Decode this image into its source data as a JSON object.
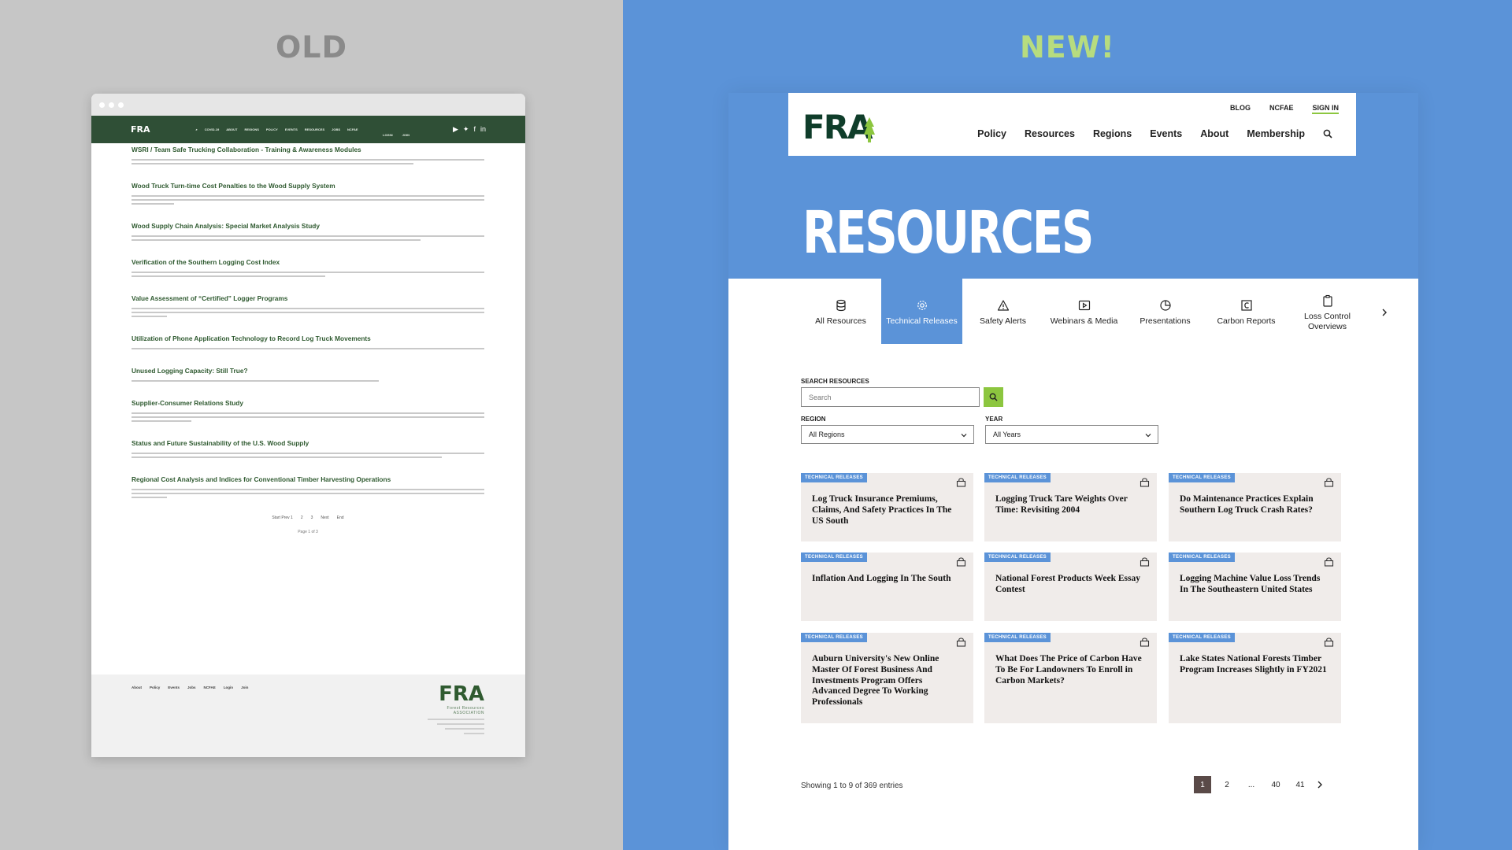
{
  "labels": {
    "old": "OLD",
    "new": "NEW!"
  },
  "old_site": {
    "logo": "FRA",
    "nav": [
      "COVID-19",
      "ABOUT",
      "REGIONS",
      "POLICY",
      "EVENTS",
      "RESOURCES",
      "JOBS",
      "NCFAE"
    ],
    "nav_secondary": [
      "LOGIN",
      "JOIN"
    ],
    "articles": [
      "WSRI / Team Safe Trucking Collaboration - Training & Awareness Modules",
      "Wood Truck Turn-time Cost Penalties to the Wood Supply System",
      "Wood Supply Chain Analysis: Special Market Analysis Study",
      "Verification of the Southern Logging Cost Index",
      "Value Assessment of “Certified” Logger Programs",
      "Utilization of Phone Application Technology to Record Log Truck Movements",
      "Unused Logging Capacity: Still True?",
      "Supplier-Consumer Relations Study",
      "Status and Future Sustainability of the U.S. Wood Supply",
      "Regional Cost Analysis and Indices for Conventional Timber Harvesting Operations"
    ],
    "pager": [
      "Start Prev 1",
      "2",
      "3",
      "Next",
      "End"
    ],
    "page_of": "Page 1 of 3",
    "footer_links": [
      "About",
      "Policy",
      "Events",
      "Jobs",
      "NCFAE",
      "Login",
      "Join"
    ],
    "footer_logo": "FRA",
    "footer_logo_sub": "Forest Resources",
    "footer_logo_sub2": "ASSOCIATION"
  },
  "new_site": {
    "logo": "FRA",
    "utility_nav": [
      "BLOG",
      "NCFAE",
      "SIGN IN"
    ],
    "main_nav": [
      "Policy",
      "Resources",
      "Regions",
      "Events",
      "About",
      "Membership"
    ],
    "page_title": "RESOURCES",
    "tabs": [
      {
        "label": "All Resources",
        "icon": "database-icon"
      },
      {
        "label": "Technical Releases",
        "icon": "gear-icon"
      },
      {
        "label": "Safety Alerts",
        "icon": "warning-icon"
      },
      {
        "label": "Webinars & Media",
        "icon": "play-icon"
      },
      {
        "label": "Presentations",
        "icon": "pie-chart-icon"
      },
      {
        "label": "Carbon Reports",
        "icon": "carbon-icon"
      },
      {
        "label": "Loss Control Overviews",
        "icon": "clipboard-icon"
      }
    ],
    "search_label": "SEARCH RESOURCES",
    "search_placeholder": "Search",
    "region_label": "REGION",
    "region_value": "All Regions",
    "year_label": "YEAR",
    "year_value": "All Years",
    "card_badge": "TECHNICAL RELEASES",
    "cards": [
      "Log Truck Insurance Premiums, Claims, And Safety Practices In The US South",
      "Logging Truck Tare Weights Over Time: Revisiting 2004",
      "Do Maintenance Practices Explain Southern Log Truck Crash Rates?",
      "Inflation And Logging In The South",
      "National Forest Products Week Essay Contest",
      "Logging Machine Value Loss Trends In The Southeastern United States",
      "Auburn University's New Online Master Of Forest Business And Investments Program Offers Advanced Degree To Working Professionals",
      "What Does The Price of Carbon Have To Be For Landowners To Enroll in Carbon Markets?",
      "Lake States National Forests Timber Program Increases Slightly in FY2021"
    ],
    "showing": "Showing 1 to 9 of 369 entries",
    "pagination": [
      "1",
      "2",
      "...",
      "40",
      "41"
    ]
  }
}
